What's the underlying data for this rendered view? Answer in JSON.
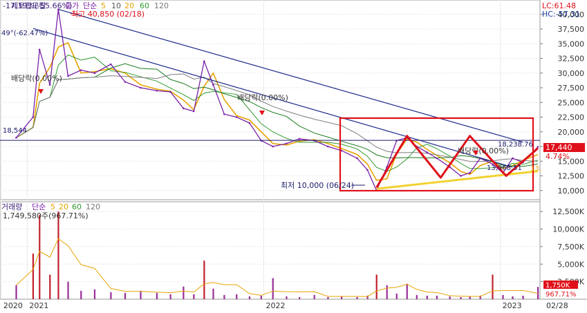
{
  "colors": {
    "price_line": "#7a1fa8",
    "ma5": "#e7a300",
    "ma10": "#8b8b8b",
    "ma20": "#2f9a2f",
    "ma60": "#1a7b1a",
    "ma120": "#7d7d7d",
    "trend": "#1a2a8a",
    "annot_red": "#e0101a",
    "support": "#f2d230",
    "ref_line": "#1a1a6a",
    "axis_text": "#333333",
    "last_price_bg": "#e0101a",
    "volume_bar": "#9a2d9a"
  },
  "legend": {
    "top": {
      "ticker": "세토탑모탑",
      "price": "종가",
      "ma": "단순",
      "periods": [
        "5",
        "10",
        "20",
        "60",
        "120"
      ],
      "line1": "-17.19%(-55.66%)",
      "line2": "49°(-62.47%)"
    },
    "vol": {
      "title": "거래량",
      "ma": "단순",
      "periods": [
        "5",
        "20",
        "60",
        "120"
      ],
      "line1": "1,749,580주(967.71%)"
    }
  },
  "badges": {
    "lc": "LC:61.48",
    "hc": "HC:-57.31"
  },
  "annotations": {
    "high": "최고 40,850 (02/18)",
    "low": "최저 10,000 (06/24)",
    "div1": "배당락(0.00%)",
    "div2": "배당락(0.00%)",
    "div3": "배당락(0.00%)",
    "ref": "18,544",
    "trend_end": "18,238.76",
    "cross_val": "13,968.51",
    "support_end": "13,"
  },
  "price_axis": {
    "ticks": [
      "40,000",
      "37,500",
      "35,000",
      "32,500",
      "30,000",
      "27,500",
      "25,000",
      "22,500",
      "20,000",
      "17,500",
      "15,000",
      "12,500",
      "10,000"
    ],
    "last_price": "17,440",
    "last_change": "4.74%"
  },
  "vol_axis": {
    "ticks": [
      "12,500K",
      "10,000K",
      "7,500K",
      "5,000K",
      "2,500K"
    ],
    "last_vol": "1,750K",
    "last_pct": "967.71%"
  },
  "x_axis": {
    "labels": [
      "2020",
      "2021",
      "2022",
      "2023"
    ],
    "end_label": "02/28"
  },
  "chart_data": {
    "type": "line",
    "title": "세토탑모탑",
    "xlabel": "",
    "ylabel": "",
    "ylim": [
      9500,
      41500
    ],
    "x": [
      "2020-12",
      "2021-01-10",
      "2021-01-20",
      "2021-02-05",
      "2021-02-18",
      "2021-03-05",
      "2021-03-25",
      "2021-04-15",
      "2021-05-10",
      "2021-06-01",
      "2021-06-25",
      "2021-07-20",
      "2021-08-10",
      "2021-08-30",
      "2021-09-15",
      "2021-10-01",
      "2021-10-15",
      "2021-11-01",
      "2021-11-20",
      "2021-12-10",
      "2021-12-28",
      "2022-01-15",
      "2022-02-05",
      "2022-02-25",
      "2022-03-20",
      "2022-04-10",
      "2022-05-01",
      "2022-05-25",
      "2022-06-10",
      "2022-06-24",
      "2022-07-10",
      "2022-07-25",
      "2022-08-10",
      "2022-08-25",
      "2022-09-10",
      "2022-09-25",
      "2022-10-15",
      "2022-11-01",
      "2022-11-15",
      "2022-12-01",
      "2022-12-20",
      "2023-01-05",
      "2023-01-20",
      "2023-02-05",
      "2023-02-28"
    ],
    "series": [
      {
        "name": "종가",
        "values": [
          19000,
          22500,
          34000,
          28000,
          40850,
          29500,
          30500,
          30000,
          31500,
          28500,
          27500,
          27000,
          26800,
          24000,
          23500,
          32000,
          28000,
          23000,
          22500,
          21500,
          18500,
          17500,
          18000,
          18800,
          18500,
          17500,
          16800,
          15500,
          13500,
          10000,
          14000,
          18500,
          19000,
          17500,
          16500,
          15500,
          14000,
          12500,
          13000,
          15500,
          14500,
          13000,
          15500,
          14800,
          17440
        ]
      }
    ],
    "volume": {
      "name": "거래량",
      "unit": "K",
      "ylim": [
        0,
        13500
      ],
      "values": [
        2000,
        6500,
        12000,
        3500,
        12500,
        2500,
        1200,
        1400,
        1000,
        900,
        1200,
        900,
        700,
        1800,
        700,
        5500,
        1500,
        600,
        700,
        400,
        500,
        3000,
        400,
        300,
        600,
        300,
        400,
        300,
        500,
        3500,
        2000,
        800,
        2200,
        600,
        500,
        500,
        400,
        300,
        400,
        500,
        3500,
        600,
        400,
        500,
        1750
      ]
    },
    "trendlines": [
      {
        "name": "upper",
        "from": [
          "2021-02-18",
          40850
        ],
        "to": [
          "2023-02-05",
          18238.76
        ]
      },
      {
        "name": "lower",
        "from": [
          "2021-01-10",
          37600
        ],
        "to": [
          "2023-01-20",
          13968.51
        ]
      },
      {
        "name": "support",
        "from": [
          "2022-06-24",
          10300
        ],
        "to": [
          "2023-02-28",
          13300
        ]
      },
      {
        "name": "ref",
        "value": 18544
      }
    ],
    "pattern": [
      [
        "2022-06-24",
        10500
      ],
      [
        "2022-08-10",
        19300
      ],
      [
        "2022-10-01",
        12200
      ],
      [
        "2022-11-15",
        19300
      ],
      [
        "2023-01-10",
        12500
      ],
      [
        "2023-02-28",
        17200
      ]
    ]
  }
}
